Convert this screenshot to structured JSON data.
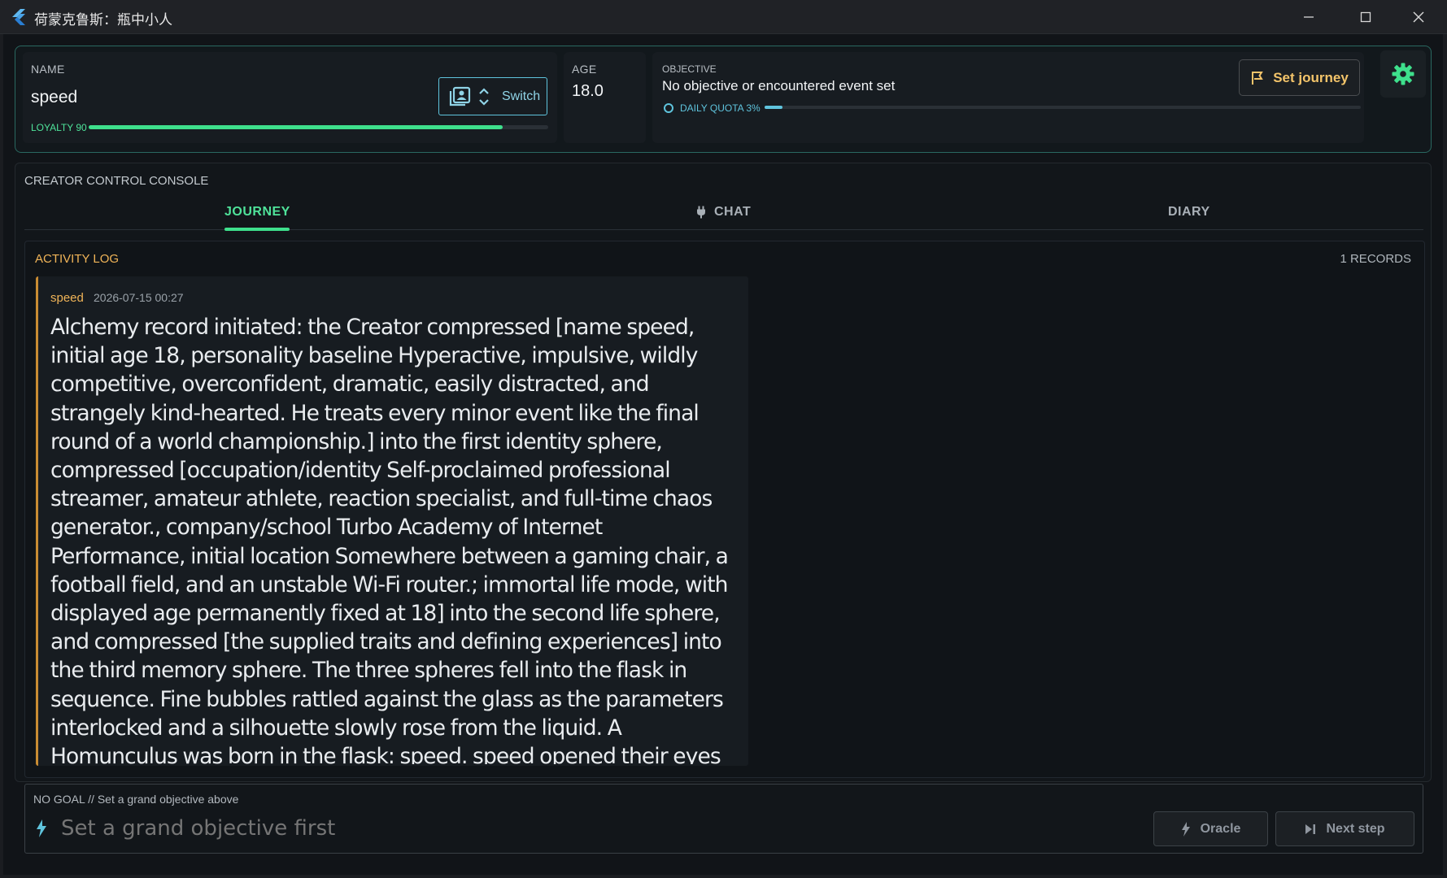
{
  "window": {
    "title": "荷蒙克鲁斯：瓶中小人",
    "controls": [
      "minimize",
      "maximize",
      "close"
    ]
  },
  "profile": {
    "name_label": "NAME",
    "name": "speed",
    "switch_label": "Switch",
    "loyalty_label": "LOYALTY 90",
    "loyalty_fraction": 0.9,
    "age_label": "AGE",
    "age": "18.0",
    "objective_label": "OBJECTIVE",
    "objective": "No objective or encountered event set",
    "quota_label": "DAILY QUOTA 3%",
    "quota_fraction": 0.03,
    "set_journey_label": "Set journey"
  },
  "console": {
    "title": "CREATOR CONTROL CONSOLE",
    "tabs": [
      {
        "label": "JOURNEY",
        "active": true
      },
      {
        "label": "CHAT",
        "active": false,
        "icon": "plug-icon"
      },
      {
        "label": "DIARY",
        "active": false
      }
    ],
    "log": {
      "title": "ACTIVITY LOG",
      "records": "1 RECORDS",
      "entries": [
        {
          "name": "speed",
          "time": "2026-07-15 00:27",
          "text": "Alchemy record initiated: the Creator compressed [name speed, initial age 18, personality baseline Hyperactive, impulsive, wildly competitive, overconfident, dramatic, easily distracted, and strangely kind-hearted. He treats every minor event like the final round of a world championship.] into the first identity sphere, compressed [occupation/identity Self-proclaimed professional streamer, amateur athlete, reaction specialist, and full-time chaos generator., company/school Turbo Academy of Internet Performance, initial location Somewhere between a gaming chair, a football field, and an unstable Wi-Fi router.; immortal life mode, with displayed age permanently fixed at 18] into the second life sphere, and compressed [the supplied traits and defining experiences] into the third memory sphere. The three spheres fell into the flask in sequence. Fine bubbles rattled against the glass as the parameters interlocked and a silhouette slowly rose from the liquid. A Homunculus was born in the flask: speed. speed opened their eyes and realized they were more than an empty record. Then speed shattered the flask, stepped through the"
        }
      ]
    }
  },
  "input": {
    "status": "NO GOAL // Set a grand objective above",
    "placeholder": "Set a grand objective first",
    "oracle_label": "Oracle",
    "next_step_label": "Next step"
  },
  "colors": {
    "accent_green": "#3ee08c",
    "accent_amber": "#f0b458",
    "accent_cyan": "#5fc4dd"
  }
}
